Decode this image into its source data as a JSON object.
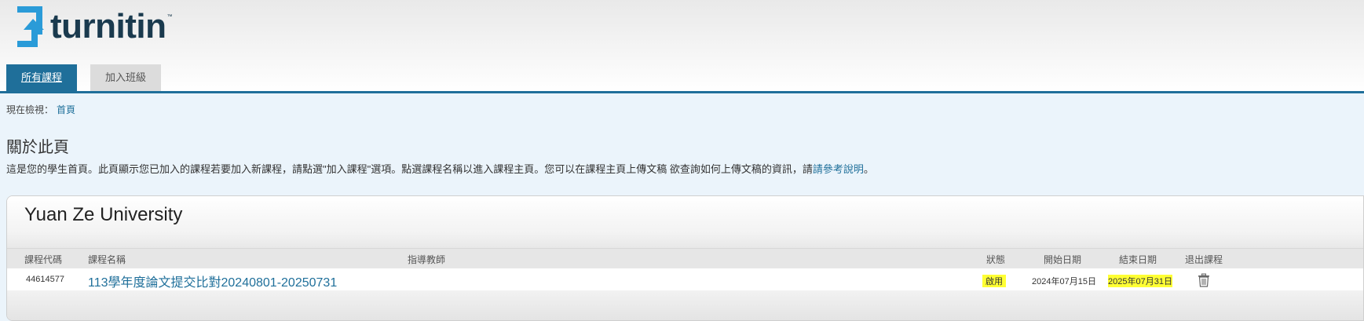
{
  "brand": {
    "name": "turnitin",
    "tm": "™",
    "logo_color": "#2a9bd8",
    "text_color": "#1a3a4e"
  },
  "tabs": [
    {
      "label": "所有課程",
      "active": true
    },
    {
      "label": "加入班級",
      "active": false
    }
  ],
  "breadcrumb": {
    "prefix": "現在檢視：",
    "current": "首頁"
  },
  "about": {
    "title": "關於此頁",
    "text": "這是您的學生首頁。此頁顯示您已加入的課程若要加入新課程，請點選\"加入課程\"選項。點選課程名稱以進入課程主頁。您可以在課程主頁上傳文稿 欲查詢如何上傳文稿的資訊，請",
    "link": "請參考說明",
    "suffix": "。"
  },
  "institution": {
    "name": "Yuan Ze University"
  },
  "table": {
    "headers": {
      "code": "課程代碼",
      "name": "課程名稱",
      "instructor": "指導教師",
      "status": "狀態",
      "start": "開始日期",
      "end": "結束日期",
      "drop": "退出課程"
    },
    "rows": [
      {
        "code": "44614577",
        "name": "113學年度論文提交比對20240801-20250731",
        "instructor": "",
        "status": "啟用",
        "start": "2024年07月15日",
        "end": "2025年07月31日",
        "drop_icon": "trash-icon"
      }
    ]
  },
  "colors": {
    "accent": "#1f6f9a",
    "highlight": "#ffff33",
    "content_bg": "#ebf4fb"
  }
}
